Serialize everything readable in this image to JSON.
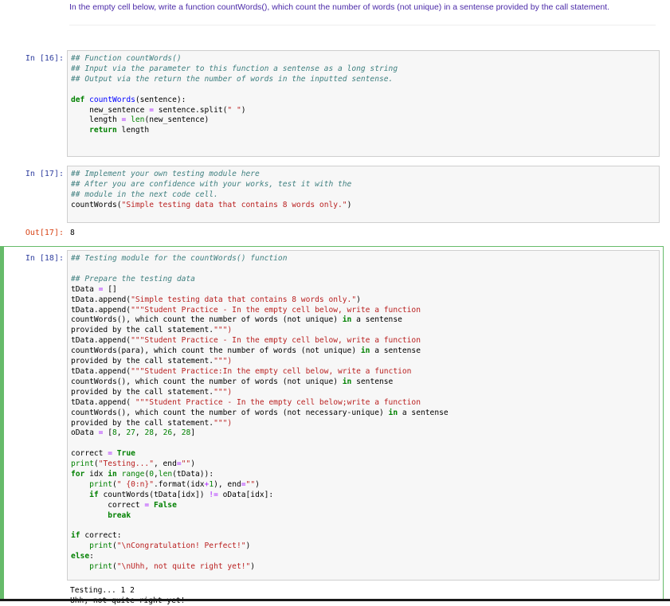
{
  "markdown": {
    "text": "In the empty cell below, write a function countWords(), which count the number of words (not unique) in a sentense provided by the call statement."
  },
  "cells": [
    {
      "prompt": "In [16]:",
      "lines": [
        "## Function countWords()",
        "## Input via the parameter to this function a sentense as a long string",
        "## Output via the return the number of words in the inputted sentense.",
        "",
        "def countWords(sentence):",
        "    new_sentence = sentence.split(\" \")",
        "    length = len(new_sentence)",
        "    return length"
      ]
    },
    {
      "prompt": "In [17]:",
      "lines": [
        "## Implement your own testing module here",
        "## After you are confidence with your works, test it with the",
        "## module in the next code cell.",
        "countWords(\"Simple testing data that contains 8 words only.\")"
      ],
      "out_prompt": "Out[17]:",
      "out_value": "8"
    },
    {
      "prompt": "In [18]:",
      "lines": [
        "## Testing module for the countWords() function",
        "",
        "## Prepare the testing data",
        "tData = []",
        "tData.append(\"Simple testing data that contains 8 words only.\")",
        "tData.append(\"\"\"Student Practice - In the empty cell below, write a function",
        "countWords(), which count the number of words (not unique) in a sentense",
        "provided by the call statement.\"\"\")",
        "tData.append(\"\"\"Student Practice - In the empty cell below, write a function",
        "countWords(para), which count the number of words (not unique) in a sentense",
        "provided by the call statement.\"\"\")",
        "tData.append(\"\"\"Student Practice:In the empty cell below, write a function",
        "countWords(), which count the number of words (not unique) in sentense",
        "provided by the call statement.\"\"\")",
        "tData.append( \"\"\"Student Practice - In the empty cell below;write a function",
        "countWords(), which count the number of words (not necessary-unique) in a sentense",
        "provided by the call statement.\"\"\")",
        "oData = [8, 27, 28, 26, 28]",
        "",
        "correct = True",
        "print(\"Testing...\", end=\"\")",
        "for idx in range(0,len(tData)):",
        "    print(\" {0:n}\".format(idx+1), end=\"\")",
        "    if countWords(tData[idx]) != oData[idx]:",
        "        correct = False",
        "        break",
        "",
        "if correct:",
        "    print(\"\\nCongratulation! Perfect!\")",
        "else:",
        "    print(\"\\nUhh, not quite right yet!\")"
      ],
      "output_lines": [
        "Testing... 1 2",
        "Uhh, not quite right yet!"
      ]
    }
  ]
}
